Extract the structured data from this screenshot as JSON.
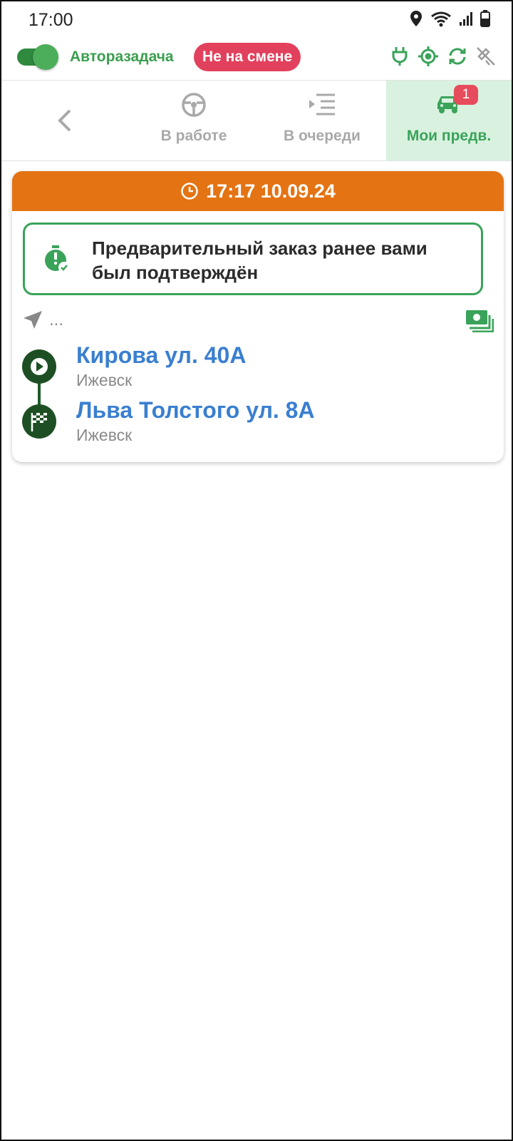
{
  "status_bar": {
    "time": "17:00"
  },
  "topbar": {
    "auto_label": "Авторазадача",
    "shift_status": "Не на смене"
  },
  "tabs": {
    "items": [
      {
        "label": "В работе",
        "icon": "steering-wheel-icon"
      },
      {
        "label": "В очереди",
        "icon": "queue-list-icon"
      },
      {
        "label": "Мои предв.",
        "icon": "car-icon",
        "badge": "1"
      }
    ]
  },
  "order": {
    "datetime": "17:17 10.09.24",
    "notice": "Предварительный заказ ранее вами был подтверждён",
    "distance": "...",
    "from": {
      "address": "Кирова ул. 40А",
      "city": "Ижевск"
    },
    "to": {
      "address": "Льва Толстого ул. 8А",
      "city": "Ижевск"
    }
  },
  "colors": {
    "accent_green": "#3aa35a",
    "header_orange": "#e47313",
    "badge_red": "#e2415d",
    "link_blue": "#3a7fd0"
  }
}
